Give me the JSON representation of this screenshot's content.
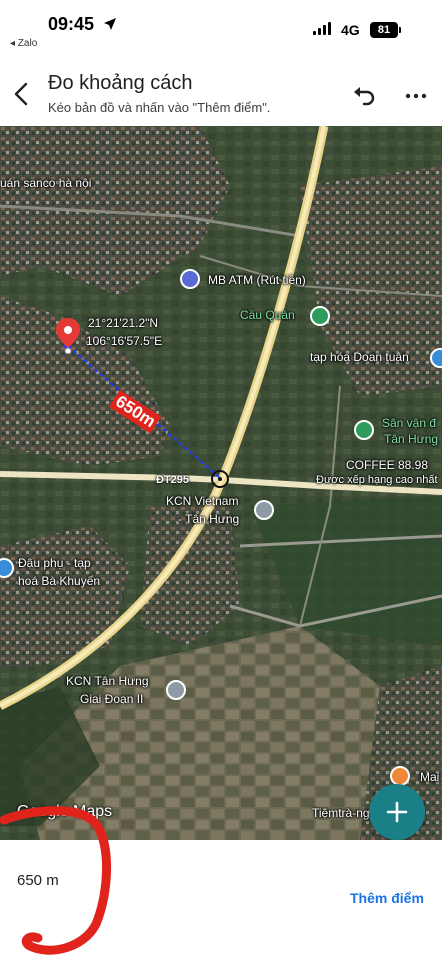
{
  "status_bar": {
    "time": "09:45",
    "back_app": "◂ Zalo",
    "network": "4G",
    "battery": "81"
  },
  "header": {
    "title": "Đo khoảng cách",
    "subtitle": "Kéo bản đồ và nhấn vào \"Thêm điểm\"."
  },
  "map": {
    "coordinates_lat": "21°21'21.2\"N",
    "coordinates_lon": "106°16'57.5\"E",
    "measured_label": "650m",
    "road_label": "ĐT295",
    "google_logo": "Google Maps",
    "places": {
      "sanco": "uán sanco hà nội",
      "mb_atm": "MB ATM (Rút tiền)",
      "cau_quan": "Cầu Quán",
      "tap_hoa_doan_tuan": "tạp hóa Doan tuân",
      "san_van_dong_1": "Sân vận đ",
      "san_van_dong_2": "Tân Hưng",
      "coffee": "COFFEE 88.98",
      "coffee_rating": "Được xếp hạng cao nhất",
      "kcn_vietnam_1": "KCN Vietnam",
      "kcn_vietnam_2": "- Tân Hưng",
      "dau_phu_1": "Đậu phụ - tạp",
      "dau_phu_2": "hoá Bà Khuyến",
      "kcn_tan_hung_1": "KCN Tân Hưng",
      "kcn_tan_hung_2": "Giai Đoạn II",
      "mai": "Mai",
      "tiem_tra": "Tiệmtrà-ngoaHuế"
    }
  },
  "bottom": {
    "distance": "650 m",
    "add_point": "Thêm điểm"
  },
  "colors": {
    "accent": "#1a73e8",
    "fab": "#1a7f86",
    "measure_line": "#1e3cff",
    "pin": "#e53935",
    "scribble": "#e0241b"
  },
  "icons": {
    "back": "arrow-left-icon",
    "undo": "undo-icon",
    "more": "more-dots-icon",
    "add": "plus-icon"
  }
}
